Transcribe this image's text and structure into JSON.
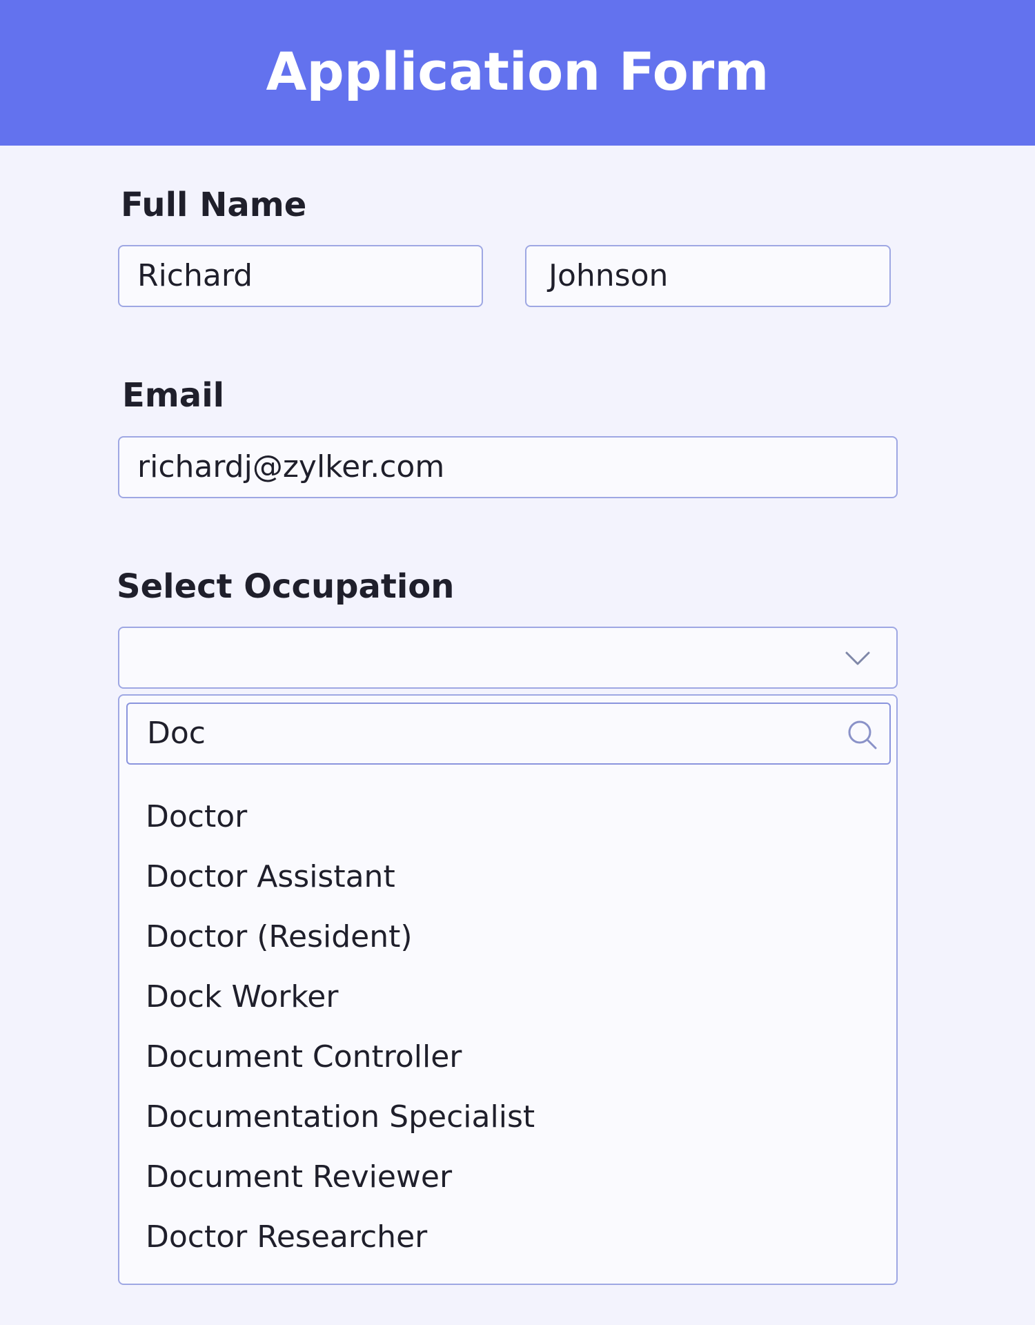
{
  "header": {
    "title": "Application Form",
    "background_color": "#6372ee"
  },
  "full_name": {
    "label": "Full Name",
    "first_name_value": "Richard",
    "last_name_value": "Johnson"
  },
  "email": {
    "label": "Email",
    "value": "richardj@zylker.com"
  },
  "occupation": {
    "label": "Select Occupation",
    "selected_value": "",
    "dropdown_icon": "chevron-down-icon",
    "search": {
      "value": "Doc",
      "icon": "search-icon"
    },
    "options": [
      "Doctor",
      "Doctor Assistant",
      "Doctor (Resident)",
      "Dock Worker",
      "Document Controller",
      "Documentation Specialist",
      "Document Reviewer",
      "Doctor Researcher"
    ]
  }
}
